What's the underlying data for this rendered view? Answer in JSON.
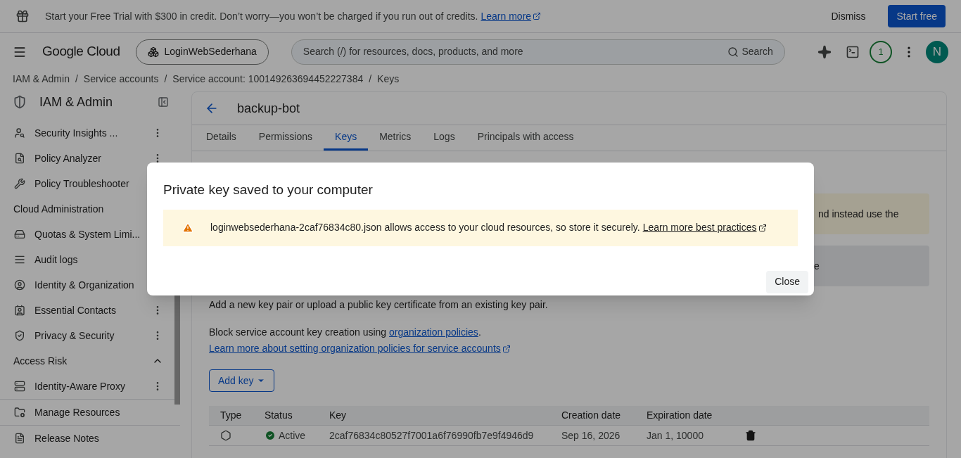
{
  "promo_banner": {
    "text": "Start your Free Trial with $300 in credit. Don’t worry—you won’t be charged if you run out of credits.",
    "link": "Learn more",
    "dismiss": "Dismiss",
    "start": "Start free"
  },
  "header": {
    "product": "Google Cloud",
    "project": "LoginWebSederhana",
    "search_placeholder": "Search (/) for resources, docs, products, and more",
    "search_button": "Search",
    "notification_count": "1",
    "avatar": "N"
  },
  "breadcrumbs": [
    {
      "label": "IAM & Admin",
      "separator": "/"
    },
    {
      "label": "Service accounts",
      "separator": "/"
    },
    {
      "label": "Service account: 100149263694452227384",
      "separator": "/"
    },
    {
      "label": "Keys"
    }
  ],
  "sidebar": {
    "title": "IAM & Admin",
    "items": [
      {
        "kind": "item",
        "label": "Security Insights ...",
        "menu": true
      },
      {
        "kind": "item",
        "label": "Policy Analyzer",
        "menu": true
      },
      {
        "kind": "item",
        "label": "Policy Troubleshooter"
      },
      {
        "kind": "section",
        "label": "Cloud Administration"
      },
      {
        "kind": "item",
        "label": "Quotas & System Limi..."
      },
      {
        "kind": "item",
        "label": "Audit logs"
      },
      {
        "kind": "item",
        "label": "Identity & Organization"
      },
      {
        "kind": "item",
        "label": "Essential Contacts",
        "menu": true
      },
      {
        "kind": "item",
        "label": "Privacy & Security",
        "menu": true
      },
      {
        "kind": "section",
        "label": "Access Risk",
        "expanded": true
      },
      {
        "kind": "item",
        "label": "Identity-Aware Proxy",
        "menu": true
      },
      {
        "kind": "footer",
        "label": "Manage Resources"
      },
      {
        "kind": "footer",
        "label": "Release Notes"
      }
    ]
  },
  "page": {
    "title": "backup-bot",
    "tabs": [
      {
        "label": "Details",
        "selected": false
      },
      {
        "label": "Permissions",
        "selected": false
      },
      {
        "label": "Keys",
        "selected": true
      },
      {
        "label": "Metrics",
        "selected": false
      },
      {
        "label": "Logs",
        "selected": false
      },
      {
        "label": "Principals with access",
        "selected": false
      }
    ],
    "warning_fragment": "nd instead use the",
    "info_fragment": "e",
    "intro": "Add a new key pair or upload a public key certificate from an existing key pair.",
    "policy_text": "Block service account key creation using",
    "policy_link": "organization policies",
    "policy_end": ".",
    "learn_link": "Learn more about setting organization policies for service accounts",
    "add_key": "Add key",
    "table": {
      "columns": [
        "Type",
        "Status",
        "Key",
        "Creation date",
        "Expiration date"
      ],
      "rows": [
        {
          "status": "Active",
          "key": "2caf76834c80527f7001a6f76990fb7e9f4946d9",
          "created": "Sep 16, 2026",
          "expires": "Jan 1, 10000"
        }
      ]
    }
  },
  "dialog": {
    "title": "Private key saved to your computer",
    "message": "loginwebsederhana-2caf76834c80.json allows access to your cloud resources, so store it securely.",
    "link": "Learn more best practices",
    "button": "Close"
  }
}
